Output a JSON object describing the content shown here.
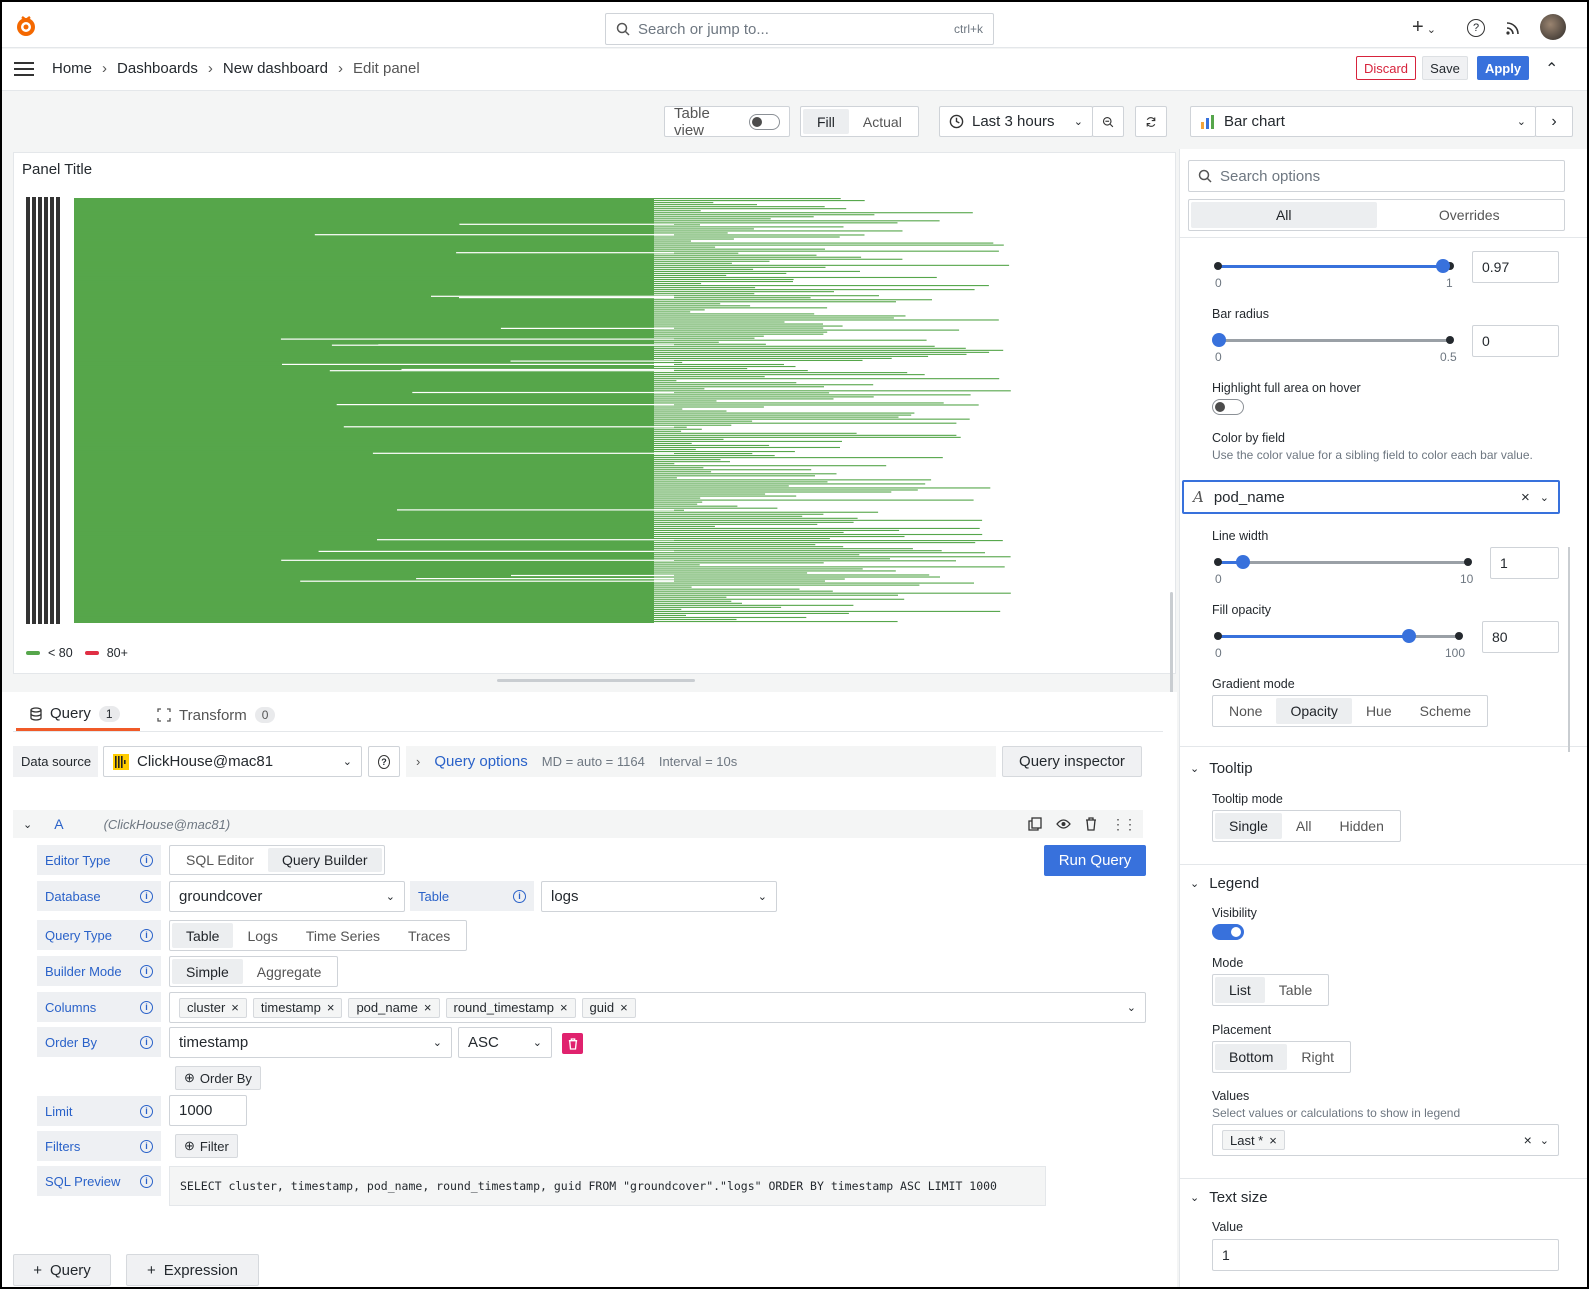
{
  "topbar": {
    "search_placeholder": "Search or jump to...",
    "search_shortcut": "ctrl+k",
    "add_label": "+"
  },
  "breadcrumb": {
    "items": [
      "Home",
      "Dashboards",
      "New dashboard",
      "Edit panel"
    ]
  },
  "actions": {
    "discard": "Discard",
    "save": "Save",
    "apply": "Apply"
  },
  "toolbar": {
    "table_view": "Table view",
    "fill": "Fill",
    "actual": "Actual",
    "time_range": "Last 3 hours",
    "visualization": "Bar chart"
  },
  "panel": {
    "title": "Panel Title",
    "legend": [
      {
        "label": "< 80",
        "color": "#56a64b"
      },
      {
        "label": "80+",
        "color": "#e02f44"
      }
    ]
  },
  "chart_data": {
    "type": "bar",
    "orientation": "horizontal",
    "bar_color": "#56a64b"
  },
  "query_tabs": [
    {
      "label": "Query",
      "count": "1"
    },
    {
      "label": "Transform",
      "count": "0"
    }
  ],
  "datasource": {
    "label": "Data source",
    "name": "ClickHouse@mac81",
    "query_options": "Query options",
    "md": "MD = auto = 1164",
    "interval": "Interval = 10s",
    "inspector": "Query inspector"
  },
  "query": {
    "ref": "A",
    "ds": "(ClickHouse@mac81)",
    "editor_type_label": "Editor Type",
    "sql_editor": "SQL Editor",
    "query_builder": "Query Builder",
    "run": "Run Query",
    "database_label": "Database",
    "database": "groundcover",
    "table_label": "Table",
    "table": "logs",
    "query_type_label": "Query Type",
    "query_types": [
      "Table",
      "Logs",
      "Time Series",
      "Traces"
    ],
    "builder_mode_label": "Builder Mode",
    "modes": [
      "Simple",
      "Aggregate"
    ],
    "columns_label": "Columns",
    "columns": [
      "cluster",
      "timestamp",
      "pod_name",
      "round_timestamp",
      "guid"
    ],
    "order_by_label": "Order By",
    "order_by": "timestamp",
    "order_dir": "ASC",
    "add_order": "Order By",
    "limit_label": "Limit",
    "limit": "1000",
    "filters_label": "Filters",
    "add_filter": "Filter",
    "sql_label": "SQL Preview",
    "sql": "SELECT cluster, timestamp, pod_name, round_timestamp, guid FROM \"groundcover\".\"logs\" ORDER BY timestamp ASC LIMIT 1000"
  },
  "bottom": {
    "add_query": "Query",
    "add_expression": "Expression"
  },
  "options": {
    "search_placeholder": "Search options",
    "tab_all": "All",
    "tab_overrides": "Overrides",
    "slider1": {
      "min": "0",
      "max": "1",
      "value": "0.97"
    },
    "bar_radius": {
      "label": "Bar radius",
      "min": "0",
      "max": "0.5",
      "value": "0"
    },
    "highlight": {
      "label": "Highlight full area on hover"
    },
    "color_by": {
      "label": "Color by field",
      "desc": "Use the color value for a sibling field to color each bar value.",
      "value": "pod_name"
    },
    "line_width": {
      "label": "Line width",
      "min": "0",
      "max": "10",
      "value": "1"
    },
    "fill_opacity": {
      "label": "Fill opacity",
      "min": "0",
      "max": "100",
      "value": "80"
    },
    "gradient": {
      "label": "Gradient mode",
      "options": [
        "None",
        "Opacity",
        "Hue",
        "Scheme"
      ]
    },
    "tooltip": {
      "title": "Tooltip",
      "mode_label": "Tooltip mode",
      "options": [
        "Single",
        "All",
        "Hidden"
      ]
    },
    "legend": {
      "title": "Legend",
      "visibility": "Visibility",
      "mode_label": "Mode",
      "modes": [
        "List",
        "Table"
      ],
      "placement_label": "Placement",
      "placements": [
        "Bottom",
        "Right"
      ],
      "values_label": "Values",
      "values_desc": "Select values or calculations to show in legend",
      "values_chip": "Last *"
    },
    "text_size": {
      "title": "Text size",
      "value_label": "Value",
      "value": "1"
    }
  }
}
